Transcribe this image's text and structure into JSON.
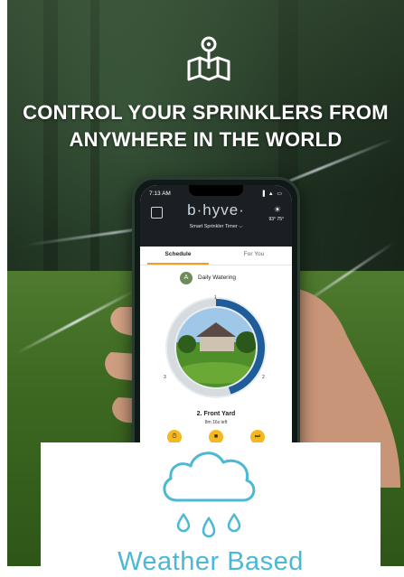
{
  "headline": {
    "line1": "CONTROL YOUR SPRINKLERS FROM",
    "line2": "ANYWHERE IN THE WORLD"
  },
  "phone": {
    "status_time": "7:13 AM",
    "status_icons": "▐ ▲ ▭",
    "brand": "b·hyve·",
    "device_selector": "Smart Sprinkler Timer  ⌵",
    "weather_temp": "93°  75°",
    "tabs": [
      "Schedule",
      "For You"
    ],
    "program_badge": "A",
    "program_name": "Daily Watering",
    "zone_name": "2. Front Yard",
    "zone_time_left": "8m 16s left",
    "ring_marks": [
      "1",
      "2",
      "3"
    ],
    "controls": [
      "⏱",
      "■",
      "⏭"
    ],
    "progress_fraction": 0.45
  },
  "card": {
    "title": "Weather Based"
  },
  "icons": [
    "map-pin-icon",
    "cloud-rain-icon",
    "calendar-icon",
    "weather-icon"
  ],
  "colors": {
    "accent_blue": "#4bb8d4",
    "ring_blue": "#1e5c9a",
    "tab_underline": "#f0a020",
    "control_yellow": "#f5b820"
  }
}
